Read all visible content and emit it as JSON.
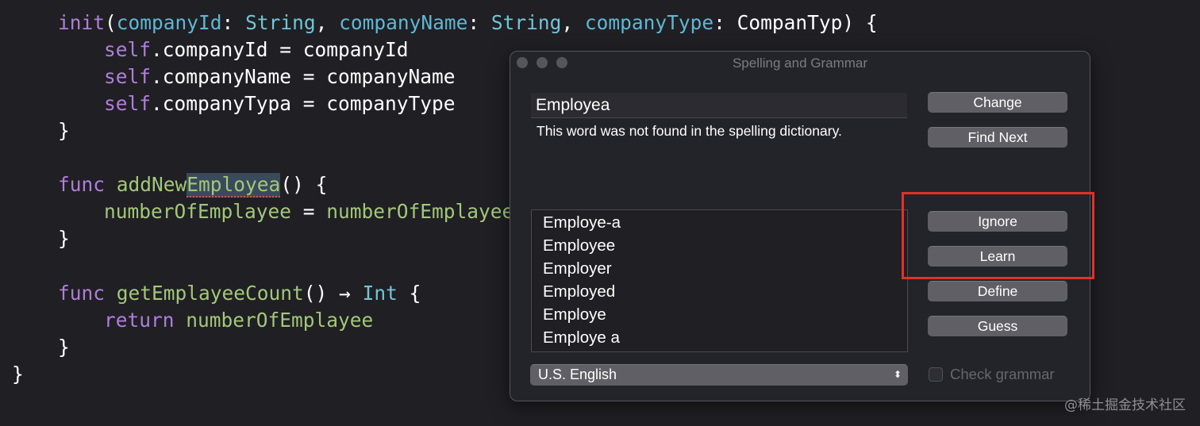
{
  "code": {
    "line1": {
      "kw": "init",
      "p1": "(",
      "a1": "companyId",
      "p2": ": ",
      "t1": "String",
      "p3": ", ",
      "a2": "companyName",
      "p4": ": ",
      "t2": "String",
      "p5": ", ",
      "a3": "companyType",
      "p6": ": CompanTyp) {"
    },
    "line2": {
      "kw": "self",
      "rest": ".companyId = companyId"
    },
    "line3": {
      "kw": "self",
      "rest": ".companyName = companyName"
    },
    "line4": {
      "kw": "self",
      "rest": ".companyTypa = companyType"
    },
    "line5": {
      "text": "}"
    },
    "line6": {
      "kw": "func",
      "name_a": "addNew",
      "name_b": "Employea",
      "rest": "() {"
    },
    "line7": {
      "var": "numberOfEmplayee",
      "eq": " = ",
      "var2": "numberOfEmplayee"
    },
    "line8": {
      "text": "}"
    },
    "line9": {
      "kw": "func",
      "name": "getEmplayeeCount",
      "p1": "() → ",
      "type": "Int",
      "p2": " {"
    },
    "line10": {
      "kw": "return",
      "var": "numberOfEmplayee"
    },
    "line11": {
      "text": "}"
    },
    "line12": {
      "text": "}"
    }
  },
  "dialog": {
    "title": "Spelling and Grammar",
    "misspelled_word": "Employea",
    "message": "This word was not found in the spelling dictionary.",
    "suggestions": [
      "Employe-a",
      "Employee",
      "Employer",
      "Employed",
      "Employe",
      "Employe a"
    ],
    "buttons": {
      "change": "Change",
      "find_next": "Find Next",
      "ignore": "Ignore",
      "learn": "Learn",
      "define": "Define",
      "guess": "Guess"
    },
    "language": "U.S. English",
    "check_grammar_label": "Check grammar",
    "check_grammar_checked": false
  },
  "annotation": {
    "highlight_color": "#e0312a"
  },
  "watermark": "@稀土掘金技术社区"
}
